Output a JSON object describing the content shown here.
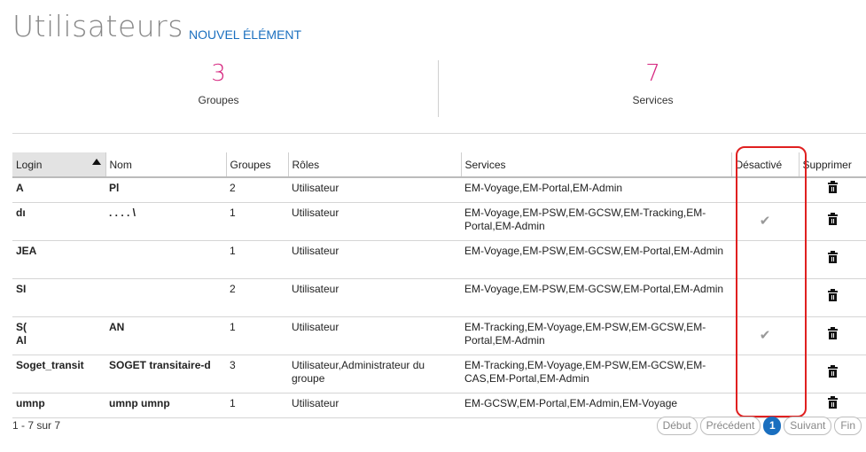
{
  "page": {
    "title": "Utilisateurs",
    "new_item": "NOUVEL ÉLÉMENT"
  },
  "stats": [
    {
      "value": "3",
      "label": "Groupes"
    },
    {
      "value": "7",
      "label": "Services"
    }
  ],
  "table": {
    "headers": [
      "Login",
      "Nom",
      "Groupes",
      "Rôles",
      "Services",
      "Désactivé",
      "Supprimer"
    ],
    "sorted_column": "Login",
    "rows": [
      {
        "login": "A",
        "nom": "Pl",
        "groupes": "2",
        "roles": "Utilisateur",
        "services": "EM-Voyage,EM-Portal,EM-Admin",
        "desactive": ""
      },
      {
        "login": "dı",
        "nom": ".   .   .   .   \\",
        "groupes": "1",
        "roles": "Utilisateur",
        "services": "EM-Voyage,EM-PSW,EM-GCSW,EM-Tracking,EM-Portal,EM-Admin",
        "desactive": "✔"
      },
      {
        "login": "JEA",
        "nom": "",
        "groupes": "1",
        "roles": "Utilisateur",
        "services": "EM-Voyage,EM-PSW,EM-GCSW,EM-Portal,EM-Admin",
        "desactive": ""
      },
      {
        "login": "SI",
        "nom": "",
        "groupes": "2",
        "roles": "Utilisateur",
        "services": "EM-Voyage,EM-PSW,EM-GCSW,EM-Portal,EM-Admin",
        "desactive": ""
      },
      {
        "login": "S(\nAl",
        "nom": "AN",
        "groupes": "1",
        "roles": "Utilisateur",
        "services": "EM-Tracking,EM-Voyage,EM-PSW,EM-GCSW,EM-Portal,EM-Admin",
        "desactive": "✔"
      },
      {
        "login": "Soget_transit",
        "nom": "SOGET transitaire-d",
        "groupes": "3",
        "roles": "Utilisateur,Administrateur du groupe",
        "services": "EM-Tracking,EM-Voyage,EM-PSW,EM-GCSW,EM-CAS,EM-Portal,EM-Admin",
        "desactive": ""
      },
      {
        "login": "umnp",
        "nom": "umnp umnp",
        "groupes": "1",
        "roles": "Utilisateur",
        "services": "EM-GCSW,EM-Portal,EM-Admin,EM-Voyage",
        "desactive": ""
      }
    ]
  },
  "footer": {
    "count": "1 - 7 sur 7"
  },
  "pager": {
    "first": "Début",
    "prev": "Précédent",
    "current": "1",
    "next": "Suivant",
    "last": "Fin"
  },
  "colors": {
    "accent": "#d6257f",
    "link": "#1a6fbf",
    "highlight": "#e02020"
  }
}
